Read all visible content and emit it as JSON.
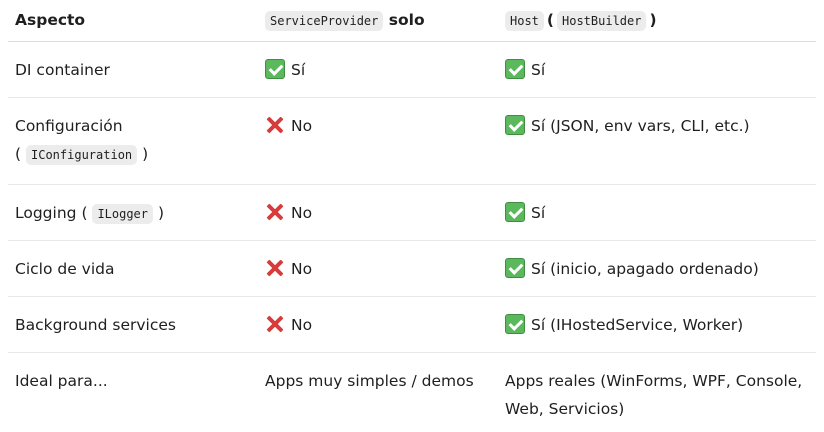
{
  "table": {
    "headers": {
      "aspect": "Aspecto",
      "col2_code": "ServiceProvider",
      "col2_text": "solo",
      "col3_code1": "Host",
      "col3_paren_open": "(",
      "col3_code2": "HostBuilder",
      "col3_paren_close": ")"
    },
    "rows": [
      {
        "aspect": "DI container",
        "col2_icon": "check-icon",
        "col2": "Sí",
        "col3_icon": "check-icon",
        "col3": "Sí"
      },
      {
        "aspect": "Configuración",
        "aspect_paren_open": "(",
        "aspect_code": "IConfiguration",
        "aspect_paren_close": ")",
        "col2_icon": "cross-icon",
        "col2": "No",
        "col3_icon": "check-icon",
        "col3": "Sí (JSON, env vars, CLI, etc.)"
      },
      {
        "aspect": "Logging",
        "aspect_paren_open": "(",
        "aspect_code": "ILogger",
        "aspect_paren_close": ")",
        "col2_icon": "cross-icon",
        "col2": "No",
        "col3_icon": "check-icon",
        "col3": "Sí"
      },
      {
        "aspect": "Ciclo de vida",
        "col2_icon": "cross-icon",
        "col2": "No",
        "col3_icon": "check-icon",
        "col3": "Sí (inicio, apagado ordenado)"
      },
      {
        "aspect": "Background services",
        "col2_icon": "cross-icon",
        "col2": "No",
        "col3_icon": "check-icon",
        "col3": "Sí (IHostedService, Worker)"
      },
      {
        "aspect": "Ideal para...",
        "col2": "Apps muy simples / demos",
        "col3": "Apps reales (WinForms, WPF, Console, Web, Servicios)"
      }
    ],
    "colors": {
      "check": "#5cb85c",
      "cross": "#d83b3b",
      "code_bg": "#ececec"
    }
  }
}
